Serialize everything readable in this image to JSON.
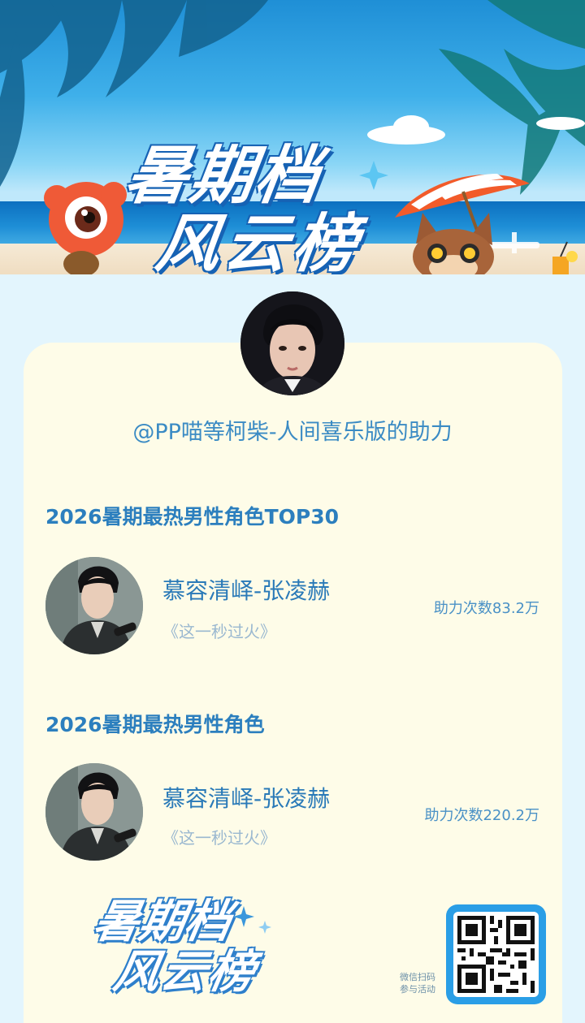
{
  "hero": {
    "title_line1": "暑期档",
    "title_line2": "风云榜"
  },
  "supporter_text": "@PP喵等柯柴-人间喜乐版的助力",
  "sections": [
    {
      "title": "2026暑期最热男性角色TOP30",
      "name": "慕容清峄-张凌赫",
      "work": "《这一秒过火》",
      "count": "助力次数83.2万"
    },
    {
      "title": "2026暑期最热男性角色",
      "name": "慕容清峄-张凌赫",
      "work": "《这一秒过火》",
      "count": "助力次数220.2万"
    }
  ],
  "footer": {
    "logo_line1": "暑期档",
    "logo_line2": "风云榜",
    "scan_line1": "微信扫码",
    "scan_line2": "参与活动"
  },
  "colors": {
    "accent": "#2c7fbe",
    "card_bg": "#fefce8",
    "page_bg": "#e3f5fd"
  }
}
